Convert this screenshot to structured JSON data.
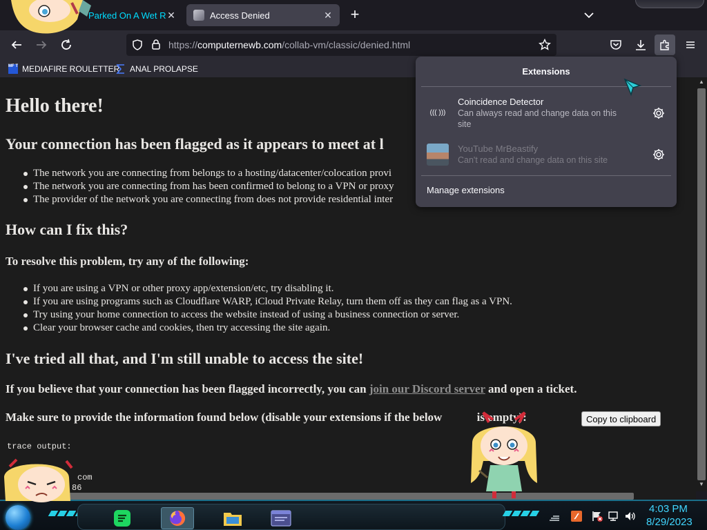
{
  "browser": {
    "tabs": [
      {
        "title": "Parked On A Wet Roa"
      },
      {
        "title": "Access Denied"
      }
    ],
    "url": {
      "scheme": "https://",
      "host": "computernewb.com",
      "path": "/collab-vm/classic/denied.html"
    },
    "bookmarks": [
      {
        "label": "MEDIAFIRE ROULETTER",
        "icon_text": "MF T"
      },
      {
        "label": "ANAL PROLAPSE"
      }
    ]
  },
  "extensions_panel": {
    "title": "Extensions",
    "items": [
      {
        "name": "Coincidence Detector",
        "description": "Can always read and change data on this site",
        "icon_text": "((( )))"
      },
      {
        "name": "YouTube MrBeastify",
        "description": "Can't read and change data on this site"
      }
    ],
    "manage_label": "Manage extensions"
  },
  "page": {
    "heading": "Hello there!",
    "flagged_heading": "Your connection has been flagged as it appears to meet at l",
    "reasons": [
      "The network you are connecting from belongs to a hosting/datacenter/colocation provi",
      "The network you are connecting from has been confirmed to belong to a VPN or proxy",
      "The provider of the network you are connecting from does not provide residential inter"
    ],
    "fix_heading": "How can I fix this?",
    "resolve_heading": "To resolve this problem, try any of the following:",
    "fixes": [
      "If you are using a VPN or other proxy app/extension/etc, try disabling it.",
      "If you are using programs such as Cloudflare WARP, iCloud Private Relay, turn them off as they can flag as a VPN.",
      "Try using your home connection to access the website instead of using a business connection or server.",
      "Clear your browser cache and cookies, then try accessing the site again."
    ],
    "tried_heading": "I've tried all that, and I'm still unable to access the site!",
    "incorrect_prefix": "If you believe that your connection has been flagged incorrectly, you can ",
    "discord_link": "join our Discord server",
    "incorrect_suffix": " and open a ticket.",
    "provide_info": "Make sure to provide the information found below (disable your extensions if the below",
    "provide_info_tail": "is empty):",
    "copy_button": "Copy to clipboard",
    "trace_label": "trace output:",
    "trace_lines": [
      "com",
      "86"
    ]
  },
  "taskbar": {
    "time": "4:03 PM",
    "date": "8/29/2023"
  },
  "colors": {
    "accent_cyan": "#00ddff",
    "clock": "#41d6ff",
    "page_bg": "#1c1c1c",
    "panel_bg": "#42414d"
  }
}
